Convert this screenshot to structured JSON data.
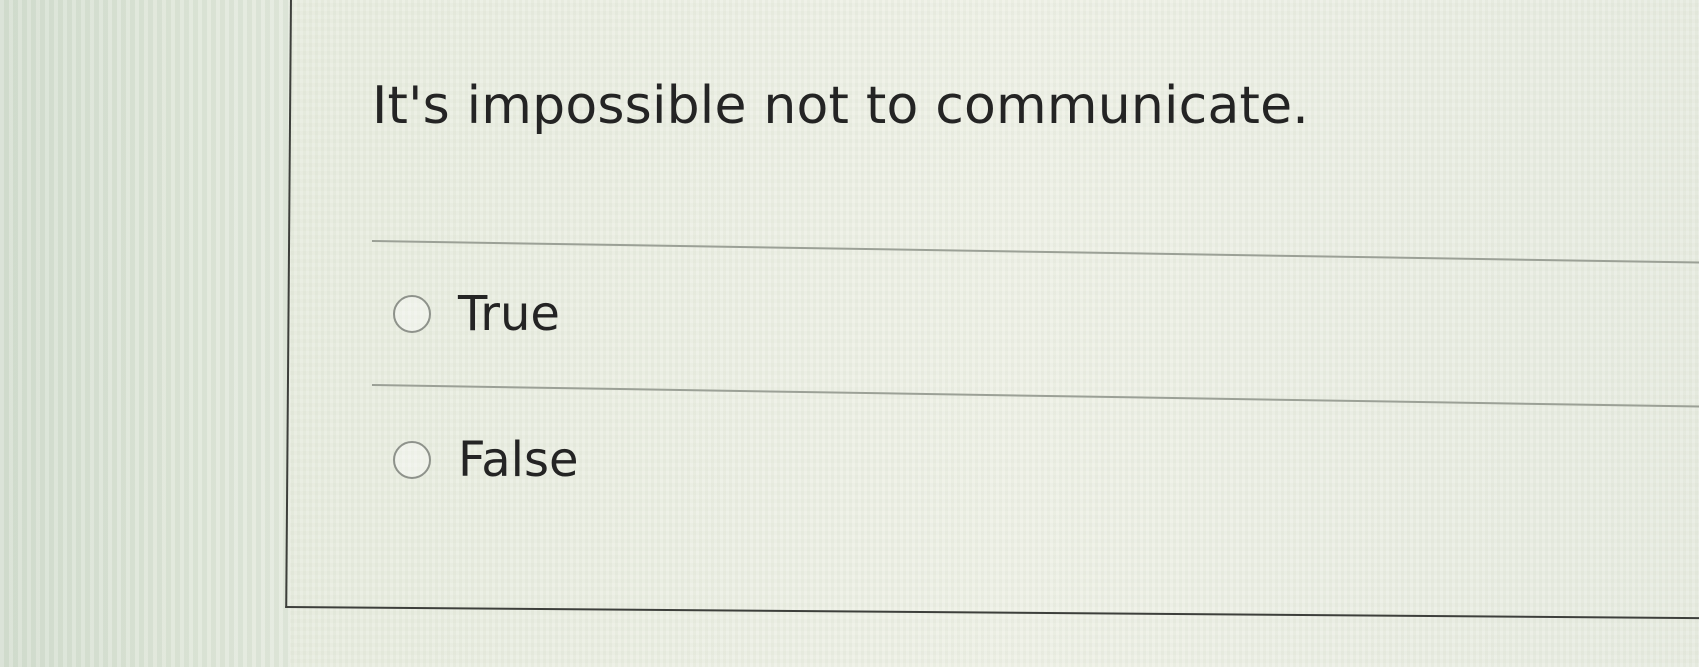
{
  "question": {
    "text": "It's impossible not to communicate."
  },
  "options": [
    {
      "label": "True",
      "selected": false
    },
    {
      "label": "False",
      "selected": false
    }
  ],
  "colors": {
    "text": "#242424",
    "divider": "#9ba096",
    "border": "#3d3f3b",
    "radio_border": "#8e928b"
  },
  "icons": {
    "radio": "radio-button-unselected"
  }
}
